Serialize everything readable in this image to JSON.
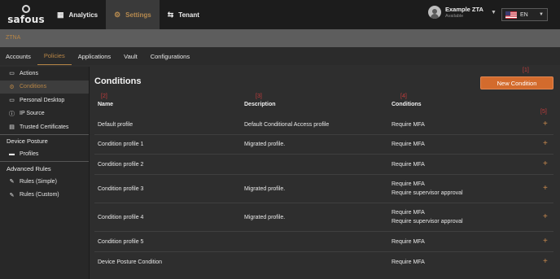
{
  "topbar": {
    "logo_text": "safous",
    "nav": [
      {
        "label": "Analytics",
        "icon": "analytics-icon"
      },
      {
        "label": "Settings",
        "icon": "gear-icon"
      },
      {
        "label": "Tenant",
        "icon": "tenant-icon"
      }
    ],
    "user": {
      "name": "Example ZTA",
      "status": "Available"
    },
    "language": {
      "label": "EN",
      "flag": "us-flag-icon"
    }
  },
  "band": {
    "label": "ZTNA"
  },
  "subnav": {
    "tabs": [
      "Accounts",
      "Policies",
      "Applications",
      "Vault",
      "Configurations"
    ]
  },
  "sidebar": {
    "items": [
      {
        "label": "Actions",
        "icon": "monitor-icon"
      },
      {
        "label": "Conditions",
        "icon": "gear-icon"
      },
      {
        "label": "Personal Desktop",
        "icon": "monitor-icon"
      },
      {
        "label": "IP Source",
        "icon": "info-icon"
      },
      {
        "label": "Trusted Certificates",
        "icon": "certificate-icon"
      }
    ],
    "group_device": "Device Posture",
    "device_items": [
      {
        "label": "Profiles",
        "icon": "profile-icon"
      }
    ],
    "group_rules": "Advanced Rules",
    "rule_items": [
      {
        "label": "Rules (Simple)",
        "icon": "tool-icon"
      },
      {
        "label": "Rules (Custom)",
        "icon": "tool-icon"
      }
    ]
  },
  "main": {
    "title": "Conditions",
    "new_button": "New Condition",
    "columns": {
      "name": "Name",
      "description": "Description",
      "conditions": "Conditions"
    },
    "markers": [
      "[1]",
      "[2]",
      "[3]",
      "[4]",
      "[5]"
    ],
    "rows": [
      {
        "name": "Default profile",
        "description": "Default Conditional Access profile",
        "conditions": [
          "Require MFA"
        ]
      },
      {
        "name": "Condition profile 1",
        "description": "Migrated profile.",
        "conditions": [
          "Require MFA"
        ]
      },
      {
        "name": "Condition profile 2",
        "description": "",
        "conditions": [
          "Require MFA"
        ]
      },
      {
        "name": "Condition profile 3",
        "description": "Migrated profile.",
        "conditions": [
          "Require MFA",
          "Require supervisor approval"
        ]
      },
      {
        "name": "Condition profile 4",
        "description": "Migrated profile.",
        "conditions": [
          "Require MFA",
          "Require supervisor approval"
        ]
      },
      {
        "name": "Condition profile 5",
        "description": "",
        "conditions": [
          "Require MFA"
        ]
      },
      {
        "name": "Device Posture Condition",
        "description": "",
        "conditions": [
          "Require MFA"
        ]
      }
    ],
    "add_symbol": "+"
  },
  "colors": {
    "accent": "#b88646",
    "button": "#d36b2d",
    "marker": "#c43c3c"
  }
}
